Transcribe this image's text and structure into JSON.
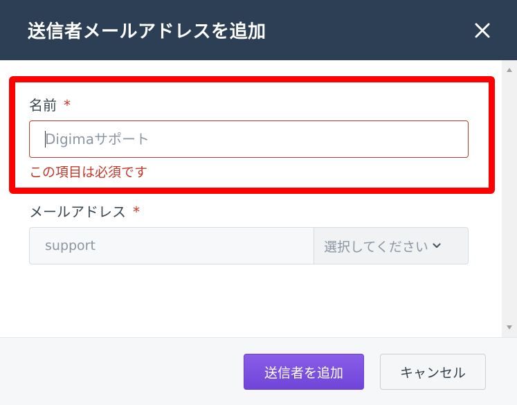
{
  "dialog": {
    "title": "送信者メールアドレスを追加"
  },
  "form": {
    "name": {
      "label": "名前",
      "required_mark": "*",
      "placeholder": "Digimaサポート",
      "value": "",
      "error": "この項目は必須です"
    },
    "email": {
      "label": "メールアドレス",
      "required_mark": "*",
      "placeholder": "support",
      "domain_select": "選択してください"
    }
  },
  "footer": {
    "submit_label": "送信者を追加",
    "cancel_label": "キャンセル"
  },
  "colors": {
    "header_bg": "#2c3f55",
    "error": "#c0392b",
    "highlight": "#ff0000",
    "primary_button": "#7a50e0"
  },
  "icons": {
    "close": "close-icon",
    "dropdown": "chevron-down-icon",
    "scroll_up": "scroll-up-arrow-icon",
    "scroll_down": "scroll-down-arrow-icon"
  }
}
